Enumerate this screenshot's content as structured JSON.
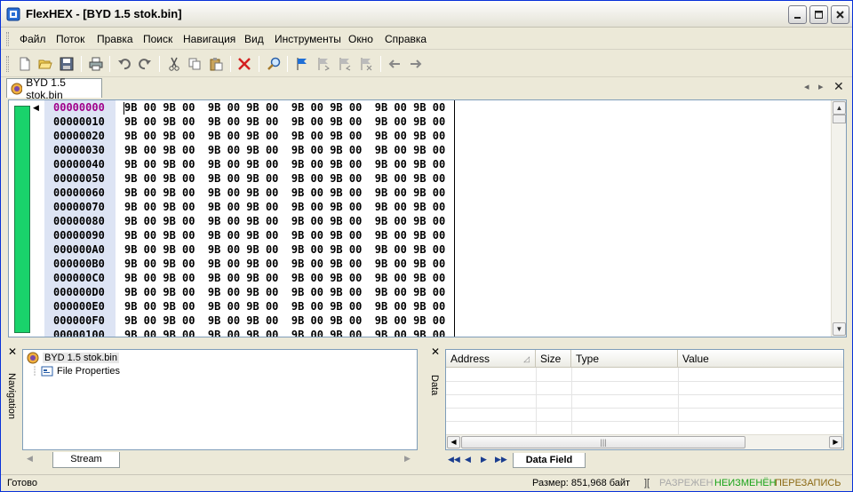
{
  "window": {
    "title": "FlexHEX - [BYD 1.5 stok.bin]"
  },
  "menu": [
    "Файл",
    "Поток",
    "Правка",
    "Поиск",
    "Навигация",
    "Вид",
    "Инструменты",
    "Окно",
    "Справка"
  ],
  "toolbar_icons": [
    "new-file-icon",
    "open-folder-icon",
    "save-icon",
    "print-icon",
    "undo-icon",
    "redo-icon",
    "cut-icon",
    "copy-icon",
    "paste-icon",
    "delete-icon",
    "find-icon",
    "flag-icon",
    "flag-next-icon",
    "flag-prev-icon",
    "flag-clear-icon",
    "back-arrow-icon",
    "forward-arrow-icon"
  ],
  "document_tab": {
    "label": "BYD 1.5 stok.bin"
  },
  "hex": {
    "offsets": [
      "00000000",
      "00000010",
      "00000020",
      "00000030",
      "00000040",
      "00000050",
      "00000060",
      "00000070",
      "00000080",
      "00000090",
      "000000A0",
      "000000B0",
      "000000C0",
      "000000D0",
      "000000E0",
      "000000F0",
      "00000100"
    ],
    "row_bytes": "9B 00 9B 00  9B 00 9B 00  9B 00 9B 00  9B 00 9B 00",
    "current_offset_color": "#a0008a"
  },
  "navigation_panel": {
    "label": "Navigation",
    "tree_root": "BYD 1.5 stok.bin",
    "tree_child": "File Properties",
    "tab": "Stream"
  },
  "data_panel": {
    "label": "Data",
    "columns": [
      "Address",
      "Size",
      "Type",
      "Value"
    ],
    "tab": "Data Field"
  },
  "status": {
    "ready": "Готово",
    "size": "Размер: 851,968 байт",
    "separator": "][",
    "sparse": "РАЗРЕЖЕН",
    "unchanged": "НЕИЗМЕНЁН",
    "overwrite": "ПЕРЕЗАПИСЬ"
  }
}
